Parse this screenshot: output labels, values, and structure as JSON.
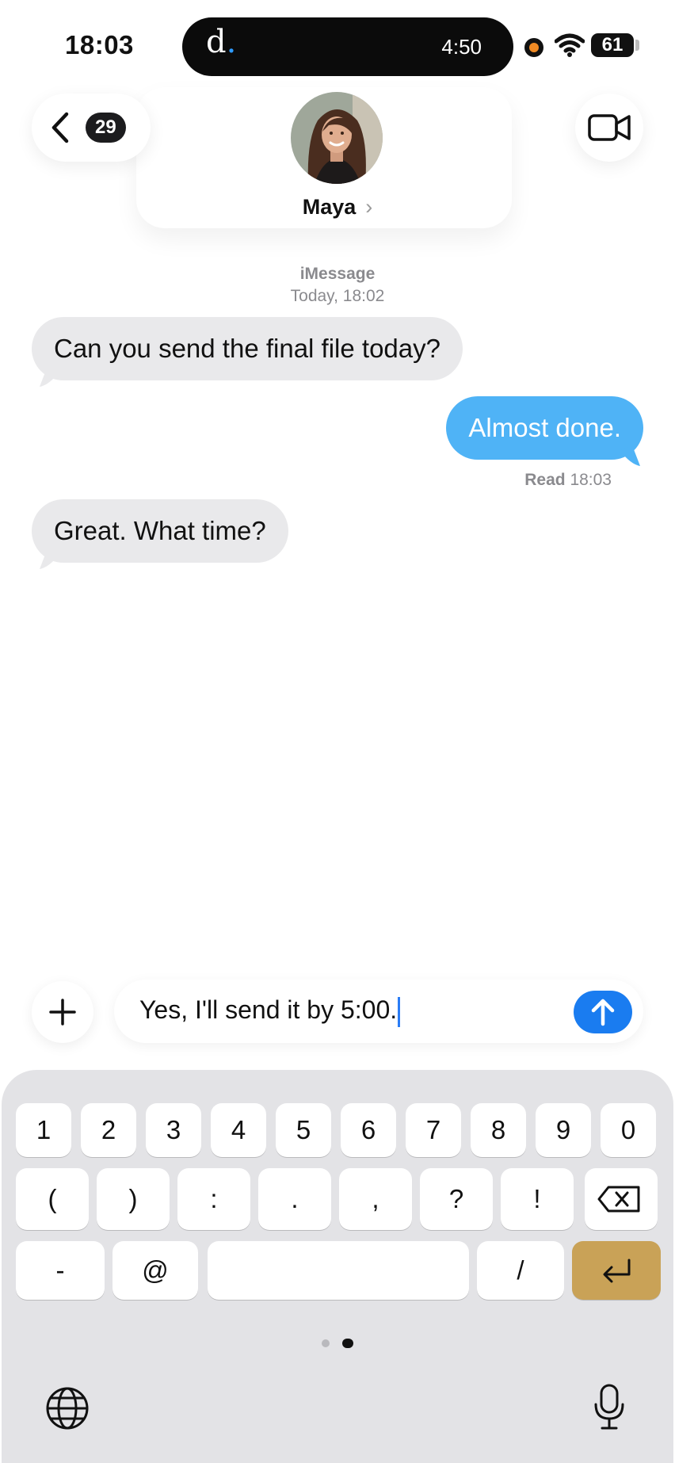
{
  "status_bar": {
    "time": "18:03",
    "island_app": "d",
    "island_timer": "4:50",
    "battery": "61",
    "icons": [
      "recording-dot",
      "wifi-icon",
      "battery-icon"
    ]
  },
  "header": {
    "unread_count": "29",
    "contact_name": "Maya",
    "chevron": "›"
  },
  "conversation": {
    "service": "iMessage",
    "timestamp": "Today, 18:02",
    "messages": [
      {
        "direction": "incoming",
        "text": "Can you send the final file today?"
      },
      {
        "direction": "outgoing",
        "text": "Almost done."
      },
      {
        "direction": "incoming",
        "text": "Great. What time?"
      }
    ],
    "receipt_label": "Read",
    "receipt_time": "18:03"
  },
  "compose": {
    "text": "Yes, I'll send it by 5:00."
  },
  "keyboard": {
    "row1": [
      "1",
      "2",
      "3",
      "4",
      "5",
      "6",
      "7",
      "8",
      "9",
      "0"
    ],
    "row2": [
      "(",
      ")",
      ":",
      ".",
      ",",
      "?",
      "!"
    ],
    "row3": [
      "-",
      "@",
      "",
      "/"
    ],
    "return_color": "#c9a257"
  },
  "colors": {
    "outgoing_bubble": "#4fb3f6",
    "incoming_bubble": "#e9e9eb",
    "send_button": "#1a7cf0",
    "keyboard_bg": "#e3e3e6"
  }
}
